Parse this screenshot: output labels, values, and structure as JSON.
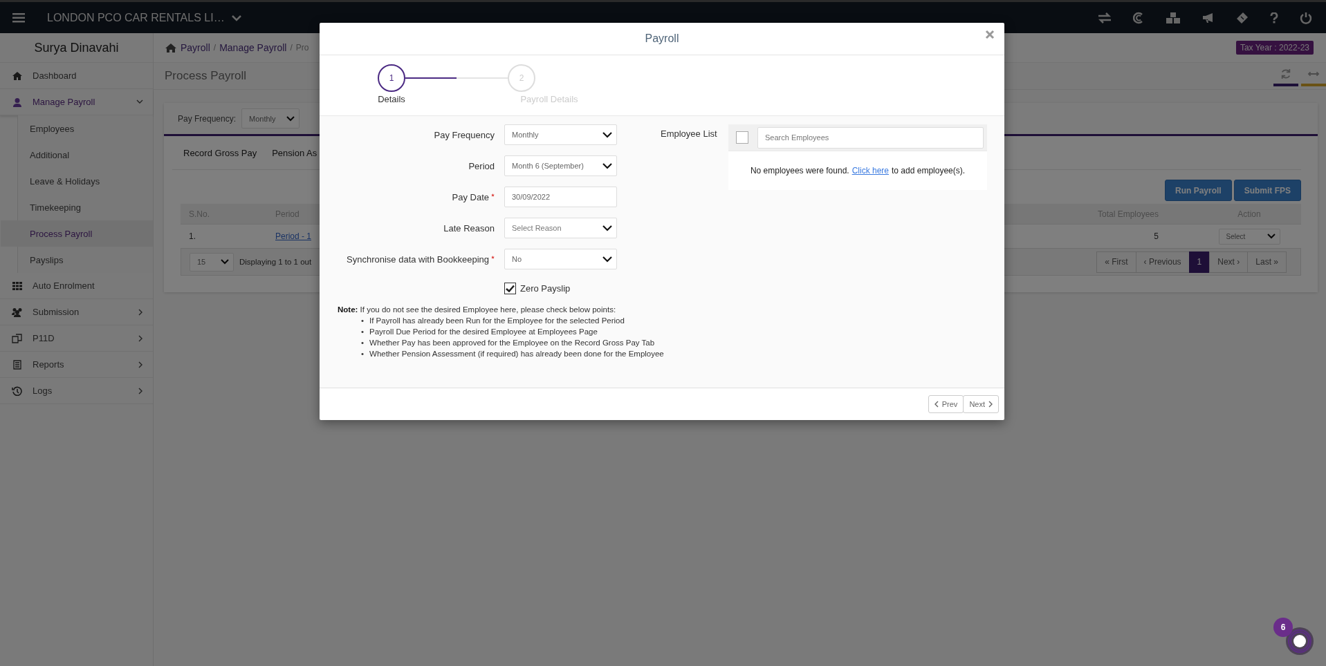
{
  "topbar": {
    "company": "LONDON PCO CAR RENTALS LI…"
  },
  "sidebar": {
    "user": "Surya Dinavahi",
    "items": [
      {
        "label": "Dashboard",
        "selected": false
      },
      {
        "label": "Manage Payroll",
        "selected": true,
        "expanded": true,
        "children": [
          {
            "label": "Employees",
            "selected": false
          },
          {
            "label": "Additional",
            "selected": false
          },
          {
            "label": "Leave & Holidays",
            "selected": false
          },
          {
            "label": "Timekeeping",
            "selected": false
          },
          {
            "label": "Process Payroll",
            "selected": true
          },
          {
            "label": "Payslips",
            "selected": false
          }
        ]
      },
      {
        "label": "Auto Enrolment",
        "selected": false
      },
      {
        "label": "Submission",
        "selected": false,
        "expanded": false
      },
      {
        "label": "P11D",
        "selected": false,
        "expanded": false
      },
      {
        "label": "Reports",
        "selected": false,
        "expanded": false
      },
      {
        "label": "Logs",
        "selected": false,
        "expanded": false
      }
    ]
  },
  "breadcrumb": {
    "items": [
      "Payroll",
      "Manage Payroll",
      "Pro"
    ],
    "separators": [
      "/",
      "/"
    ]
  },
  "tax_year": "Tax Year : 2022-23",
  "page_title": "Process Payroll",
  "filter": {
    "label": "Pay Frequency:",
    "value": "Monthly"
  },
  "tabs": [
    "Record Gross Pay",
    "Pension As"
  ],
  "actions": [
    "Run Payroll",
    "Submit FPS"
  ],
  "table": {
    "columns": [
      "S.No.",
      "Period",
      "Total Employees",
      "Action"
    ],
    "rows": [
      {
        "sno": "1.",
        "period": "Period - 1",
        "total": "5",
        "action": "Select"
      }
    ]
  },
  "pager": {
    "page_size": "15",
    "info": "Displaying 1 to 1 out",
    "pages": [
      {
        "label": "« First",
        "selected": false
      },
      {
        "label": "‹ Previous",
        "selected": false
      },
      {
        "label": "1",
        "selected": true
      },
      {
        "label": "Next ›",
        "selected": false
      },
      {
        "label": "Last »",
        "selected": false
      }
    ]
  },
  "modal": {
    "title": "Payroll",
    "steps": [
      {
        "number": "1",
        "label": "Details",
        "selected": true
      },
      {
        "number": "2",
        "label": "Payroll Details",
        "selected": false
      }
    ],
    "fields": [
      {
        "label": "Pay Frequency",
        "kind": "select",
        "value": "Monthly",
        "required": false
      },
      {
        "label": "Period",
        "kind": "select",
        "value": "Month 6 (September)",
        "required": false
      },
      {
        "label": "Pay Date",
        "kind": "text",
        "value": "30/09/2022",
        "required": true
      },
      {
        "label": "Late Reason",
        "kind": "select",
        "placeholder": "Select Reason",
        "required": false
      },
      {
        "label": "Synchronise data with Bookkeeping",
        "kind": "select",
        "value": "No",
        "required": true
      }
    ],
    "zero_payslip": {
      "label": "Zero Payslip",
      "checked": true
    },
    "note": "**Note:** If you do not see the desired Employee here, please check below points:",
    "points": [
      {
        "bullet": "•",
        "text": "If Payroll has already been Run for the Employee for the selected Period"
      },
      {
        "bullet": "•",
        "text": "Payroll Due Period for the desired Employee at Employees Page"
      },
      {
        "bullet": "•",
        "text": "Whether Pay has been approved for the Employee on the Record Gross Pay Tab"
      },
      {
        "bullet": "•",
        "text": "Whether Pension Assessment (if required) has already been done for the Employee"
      }
    ],
    "employee_list": {
      "label": "Employee List",
      "select_all_checked": false,
      "search_placeholder": "Search Employees",
      "message": "No employees were found.",
      "link": "Click here",
      "message_tail": "to add employee(s)."
    },
    "buttons": [
      "Prev",
      "Next"
    ]
  },
  "chat": {
    "count": "6"
  }
}
